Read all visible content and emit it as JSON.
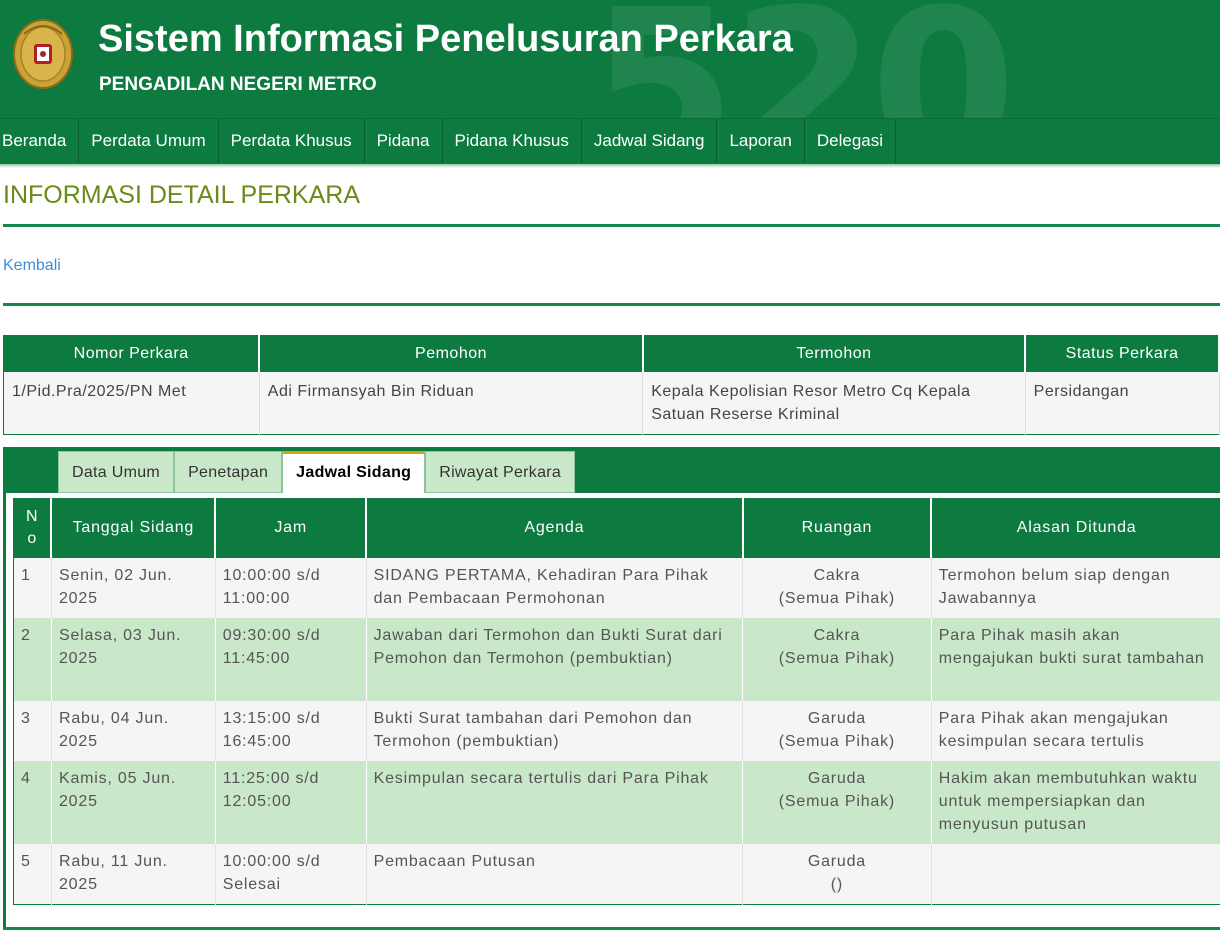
{
  "header": {
    "title": "Sistem Informasi Penelusuran Perkara",
    "subtitle": "PENGADILAN NEGERI METRO",
    "watermark": "520"
  },
  "nav": {
    "items": [
      "Beranda",
      "Perdata Umum",
      "Perdata Khusus",
      "Pidana",
      "Pidana Khusus",
      "Jadwal Sidang",
      "Laporan",
      "Delegasi"
    ]
  },
  "page": {
    "title": "INFORMASI DETAIL PERKARA",
    "back_label": "Kembali"
  },
  "case": {
    "headers": [
      "Nomor Perkara",
      "Pemohon",
      "Termohon",
      "Status Perkara"
    ],
    "values": [
      "1/Pid.Pra/2025/PN Met",
      "Adi Firmansyah Bin Riduan",
      "Kepala Kepolisian Resor Metro Cq Kepala Satuan Reserse Kriminal",
      "Persidangan"
    ]
  },
  "tabs": {
    "items": [
      "Data Umum",
      "Penetapan",
      "Jadwal Sidang",
      "Riwayat Perkara"
    ],
    "active": "Jadwal Sidang"
  },
  "schedule": {
    "headers": [
      "No",
      "Tanggal Sidang",
      "Jam",
      "Agenda",
      "Ruangan",
      "Alasan Ditunda"
    ],
    "rows": [
      {
        "no": "1",
        "tanggal": "Senin, 02 Jun. 2025",
        "jam": "10:00:00 s/d 11:00:00",
        "agenda": "SIDANG PERTAMA, Kehadiran Para Pihak dan Pembacaan Permohonan",
        "ruang": "Cakra",
        "ruang_sub": "(Semua Pihak)",
        "alasan": "Termohon belum siap dengan Jawabannya"
      },
      {
        "no": "2",
        "tanggal": "Selasa, 03 Jun. 2025",
        "jam": "09:30:00 s/d 11:45:00",
        "agenda": "Jawaban dari Termohon dan Bukti Surat dari Pemohon dan Termohon (pembuktian)",
        "ruang": "Cakra",
        "ruang_sub": "(Semua Pihak)",
        "alasan": "Para Pihak masih akan mengajukan bukti surat tambahan"
      },
      {
        "no": "3",
        "tanggal": "Rabu, 04 Jun. 2025",
        "jam": "13:15:00 s/d 16:45:00",
        "agenda": "Bukti Surat tambahan dari Pemohon dan Termohon (pembuktian)",
        "ruang": "Garuda",
        "ruang_sub": "(Semua Pihak)",
        "alasan": "Para Pihak akan mengajukan kesimpulan secara tertulis"
      },
      {
        "no": "4",
        "tanggal": "Kamis, 05 Jun. 2025",
        "jam": "11:25:00 s/d 12:05:00",
        "agenda": "Kesimpulan secara tertulis dari Para Pihak",
        "ruang": "Garuda",
        "ruang_sub": "(Semua Pihak)",
        "alasan": "Hakim akan membutuhkan waktu untuk mempersiapkan dan menyusun putusan"
      },
      {
        "no": "5",
        "tanggal": "Rabu, 11 Jun. 2025",
        "jam": "10:00:00 s/d Selesai",
        "agenda": "Pembacaan Putusan",
        "ruang": "Garuda",
        "ruang_sub": "()",
        "alasan": ""
      }
    ]
  },
  "colors": {
    "brand_green": "#0d7a3f",
    "light_green_row": "#c9e8c9",
    "title_olive": "#6a8a1a",
    "link_blue": "#3a8ed8",
    "tab_accent": "#d4a018"
  },
  "icons": {
    "logo": "court-emblem-icon"
  }
}
